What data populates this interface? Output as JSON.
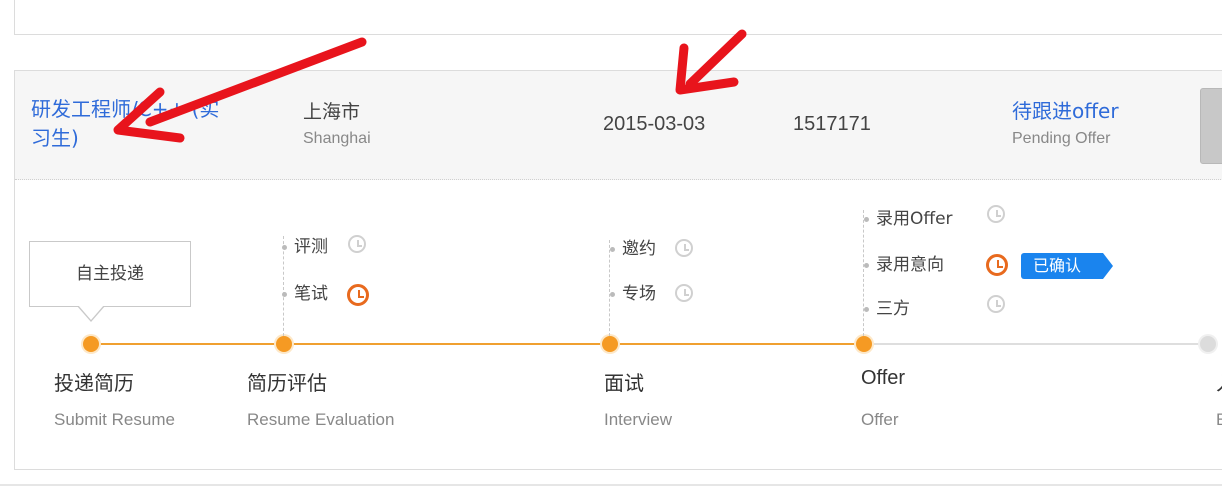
{
  "job": {
    "title": "研发工程师/C++ (实习生)",
    "city_cn": "上海市",
    "city_en": "Shanghai",
    "date": "2015-03-03",
    "job_id": "1517171",
    "status_cn": "待跟进offer",
    "status_en": "Pending Offer"
  },
  "tooltip": {
    "text": "自主投递"
  },
  "stages": [
    {
      "cn": "投递简历",
      "en": "Submit Resume"
    },
    {
      "cn": "简历评估",
      "en": "Resume Evaluation"
    },
    {
      "cn": "面试",
      "en": "Interview"
    },
    {
      "cn": "Offer",
      "en": "Offer"
    },
    {
      "cn": "入",
      "en": "E"
    }
  ],
  "substeps": {
    "evaluation": [
      {
        "label": "评测",
        "clock": "clock-icon"
      },
      {
        "label": "笔试",
        "clock": "clock-active-icon"
      }
    ],
    "interview": [
      {
        "label": "邀约",
        "clock": "clock-icon"
      },
      {
        "label": "专场",
        "clock": "clock-icon"
      }
    ],
    "offer": [
      {
        "label": "录用Offer",
        "clock": "clock-icon"
      },
      {
        "label": "录用意向",
        "clock": "clock-active-icon"
      },
      {
        "label": "三方",
        "clock": "clock-icon"
      }
    ]
  },
  "offer_badge": "已确认",
  "colors": {
    "accent_orange": "#f59a23",
    "link_blue": "#2f6bd9",
    "badge_blue": "#1a84ee",
    "annotation_red": "#e8141c"
  }
}
